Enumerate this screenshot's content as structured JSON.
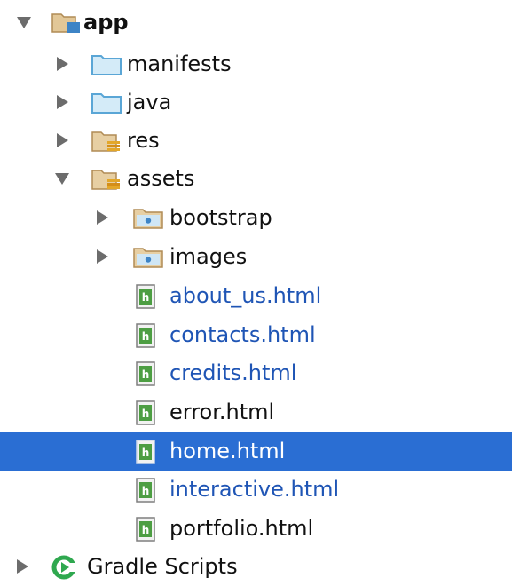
{
  "tree": {
    "app": {
      "label": "app",
      "icon": "module-folder-icon",
      "expanded": true
    },
    "manifests": {
      "label": "manifests",
      "icon": "folder-icon",
      "expanded": false
    },
    "java": {
      "label": "java",
      "icon": "folder-icon",
      "expanded": false
    },
    "res": {
      "label": "res",
      "icon": "resource-folder-icon",
      "expanded": false
    },
    "assets": {
      "label": "assets",
      "icon": "resource-folder-icon",
      "expanded": true
    },
    "bootstrap": {
      "label": "bootstrap",
      "icon": "package-folder-icon",
      "expanded": false
    },
    "images": {
      "label": "images",
      "icon": "package-folder-icon",
      "expanded": false
    },
    "files": [
      {
        "label": "about_us.html",
        "icon": "html-file-icon",
        "color": "blue"
      },
      {
        "label": "contacts.html",
        "icon": "html-file-icon",
        "color": "blue"
      },
      {
        "label": "credits.html",
        "icon": "html-file-icon",
        "color": "blue"
      },
      {
        "label": "error.html",
        "icon": "html-file-icon",
        "color": "dark"
      },
      {
        "label": "home.html",
        "icon": "html-file-icon",
        "color": "dark",
        "selected": true
      },
      {
        "label": "interactive.html",
        "icon": "html-file-icon",
        "color": "blue"
      },
      {
        "label": "portfolio.html",
        "icon": "html-file-icon",
        "color": "dark"
      }
    ],
    "gradle": {
      "label": "Gradle Scripts",
      "icon": "gradle-icon",
      "expanded": false
    }
  },
  "colors": {
    "selection": "#2a6ed3",
    "vcs_modified": "#1f55b5",
    "folder_blue": "#6fb3e0",
    "folder_tan": "#d7b589",
    "html_green": "#4d9e43",
    "gradle_green": "#2fa84f"
  }
}
